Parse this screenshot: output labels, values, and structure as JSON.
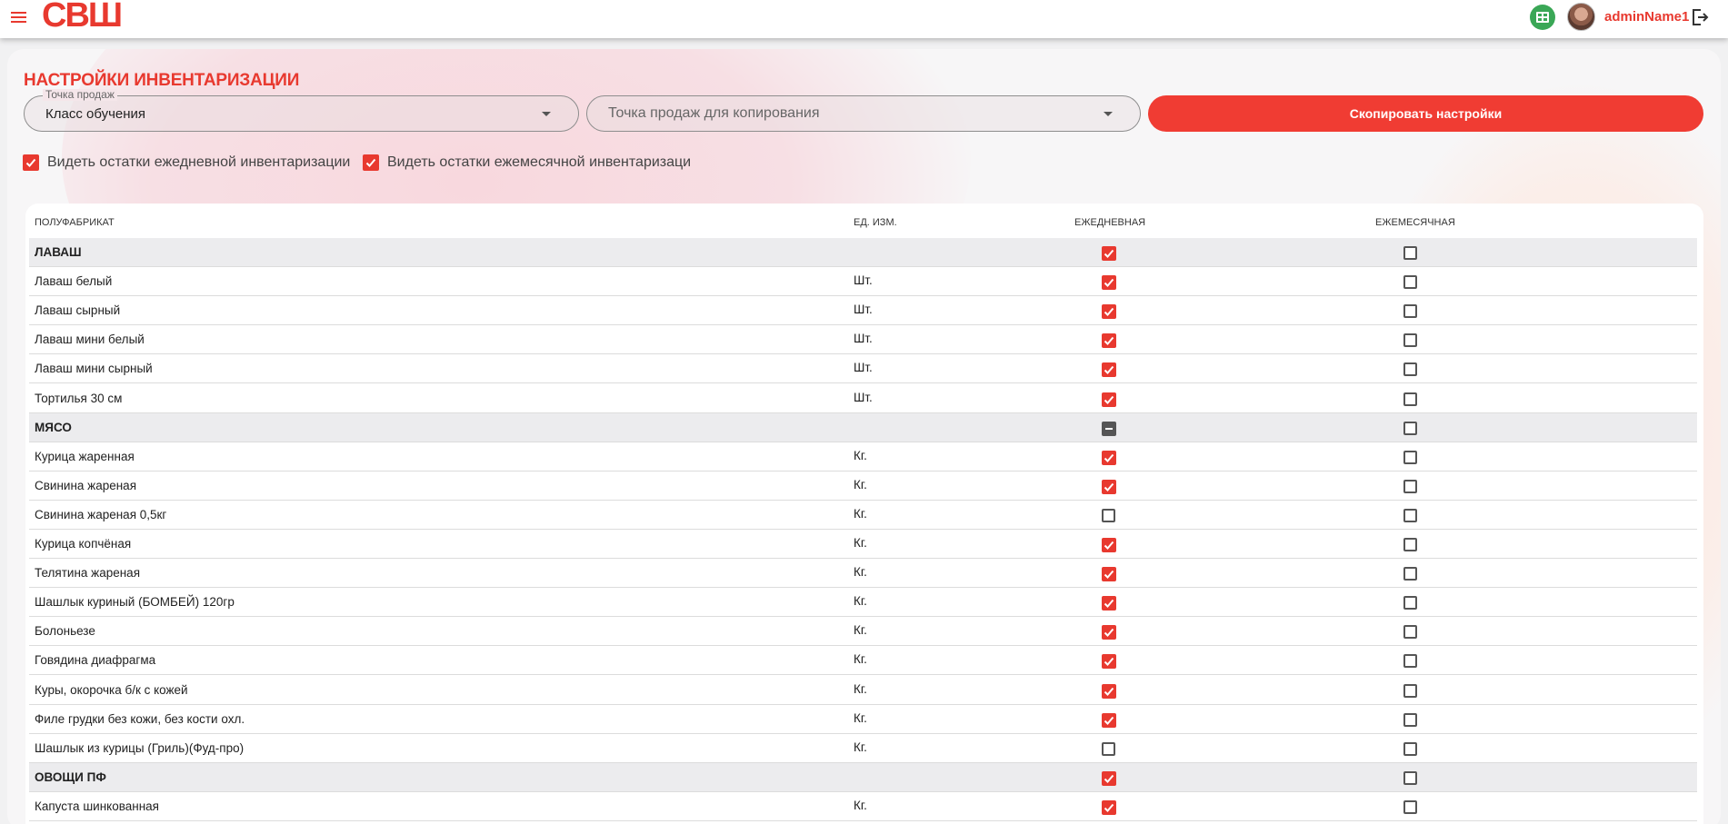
{
  "header": {
    "logo": "СВШ",
    "user_name": "adminName1",
    "icons": [
      "menu-icon",
      "excel-icon",
      "avatar",
      "logout-icon"
    ]
  },
  "page": {
    "title": "НАСТРОЙКИ ИНВЕНТАРИЗАЦИИ"
  },
  "filters": {
    "sales_point_label": "Точка продаж",
    "sales_point_value": "Класс обучения",
    "copy_point_placeholder": "Точка продаж для копирования",
    "copy_button": "Скопировать настройки"
  },
  "options": {
    "daily_label": "Видеть остатки ежедневной инвентаризации",
    "daily_checked": true,
    "monthly_label": "Видеть остатки ежемесячной инвентаризаци",
    "monthly_checked": true
  },
  "table": {
    "headers": {
      "name": "ПОЛУФАБРИКАТ",
      "unit": "ЕД. ИЗМ.",
      "daily": "ЕЖЕДНЕВНАЯ",
      "monthly": "ЕЖЕМЕСЯЧНАЯ"
    },
    "rows": [
      {
        "name": "ЛАВАШ",
        "unit": "",
        "group": true,
        "daily": "on",
        "monthly": "off"
      },
      {
        "name": "Лаваш белый",
        "unit": "Шт.",
        "group": false,
        "daily": "on",
        "monthly": "off"
      },
      {
        "name": "Лаваш сырный",
        "unit": "Шт.",
        "group": false,
        "daily": "on",
        "monthly": "off"
      },
      {
        "name": "Лаваш мини белый",
        "unit": "Шт.",
        "group": false,
        "daily": "on",
        "monthly": "off"
      },
      {
        "name": "Лаваш мини сырный",
        "unit": "Шт.",
        "group": false,
        "daily": "on",
        "monthly": "off"
      },
      {
        "name": "Тортилья 30 см",
        "unit": "Шт.",
        "group": false,
        "daily": "on",
        "monthly": "off"
      },
      {
        "name": "МЯСО",
        "unit": "",
        "group": true,
        "daily": "ind",
        "monthly": "off"
      },
      {
        "name": "Курица жаренная",
        "unit": "Кг.",
        "group": false,
        "daily": "on",
        "monthly": "off"
      },
      {
        "name": "Свинина жареная",
        "unit": "Кг.",
        "group": false,
        "daily": "on",
        "monthly": "off"
      },
      {
        "name": "Свинина жареная 0,5кг",
        "unit": "Кг.",
        "group": false,
        "daily": "off",
        "monthly": "off"
      },
      {
        "name": "Курица копчёная",
        "unit": "Кг.",
        "group": false,
        "daily": "on",
        "monthly": "off"
      },
      {
        "name": "Телятина жареная",
        "unit": "Кг.",
        "group": false,
        "daily": "on",
        "monthly": "off"
      },
      {
        "name": "Шашлык куриный (БОМБЕЙ) 120гр",
        "unit": "Кг.",
        "group": false,
        "daily": "on",
        "monthly": "off"
      },
      {
        "name": "Болоньезе",
        "unit": "Кг.",
        "group": false,
        "daily": "on",
        "monthly": "off"
      },
      {
        "name": "Говядина диафрагма",
        "unit": "Кг.",
        "group": false,
        "daily": "on",
        "monthly": "off"
      },
      {
        "name": "Куры, окорочка б/к с кожей",
        "unit": "Кг.",
        "group": false,
        "daily": "on",
        "monthly": "off"
      },
      {
        "name": "Филе грудки без кожи, без кости охл.",
        "unit": "Кг.",
        "group": false,
        "daily": "on",
        "monthly": "off"
      },
      {
        "name": "Шашлык из курицы (Гриль)(Фуд-про)",
        "unit": "Кг.",
        "group": false,
        "daily": "off",
        "monthly": "off"
      },
      {
        "name": "ОВОЩИ ПФ",
        "unit": "",
        "group": true,
        "daily": "on",
        "monthly": "off"
      },
      {
        "name": "Капуста шинкованная",
        "unit": "Кг.",
        "group": false,
        "daily": "on",
        "monthly": "off"
      }
    ]
  }
}
